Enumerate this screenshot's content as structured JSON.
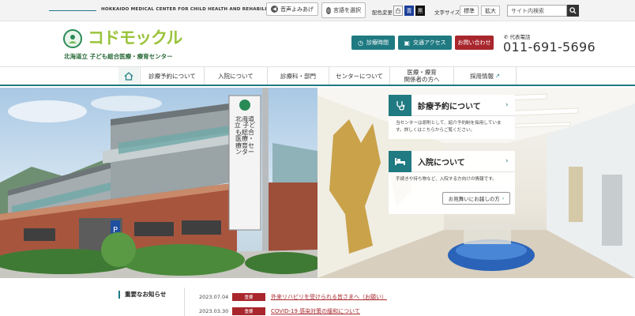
{
  "topbar": {
    "org_english": "HOKKAIDO MEDICAL CENTER FOR CHILD HEALTH AND REHABILITATION",
    "read_aloud": "音声よみあげ",
    "language": "言語を選択",
    "color_label": "配色変更",
    "color_white": "白",
    "color_blue": "青",
    "color_black": "黒",
    "text_size_label": "文字サイズ",
    "size_standard": "標準",
    "size_large": "拡大",
    "search_placeholder": "サイト内検索"
  },
  "header": {
    "logo_text": "コドモックル",
    "logo_sub": "北海道立 子ども総合医療・療育センター",
    "hours": "診療時間",
    "access": "交通アクセス",
    "contact": "お問い合わせ",
    "phone_label": "代表電話",
    "phone_number": "011-691-5696"
  },
  "nav": {
    "items": [
      {
        "label": "診療予約について"
      },
      {
        "label": "入院について"
      },
      {
        "label": "診療科・部門"
      },
      {
        "label": "センターについて"
      },
      {
        "label": "医療・療育\n関係者の方へ"
      },
      {
        "label": "採用情報"
      }
    ]
  },
  "hero": {
    "building_sign": "北海道立 子ども総合医療・療育センター",
    "card1": {
      "title": "診療予約について",
      "body": "当センターは原則として、紹介予約制を採用しています。詳しくはこちらからご覧ください。"
    },
    "card2": {
      "title": "入院について",
      "body": "手続きや持ち物など、入院する方向けの情報です。",
      "link": "お見舞いにお越しの方"
    }
  },
  "news": {
    "heading": "重要なお知らせ",
    "items": [
      {
        "date": "2023.07.04",
        "badge": "重要",
        "title": "外来リハビリを受けられる皆さまへ（お願い）"
      },
      {
        "date": "2023.03.30",
        "badge": "重要",
        "title": "COVID-19 感染対策の緩和について"
      }
    ]
  },
  "colors": {
    "teal": "#1f7a82",
    "red": "#a8262c",
    "logo_green": "#9ac43c"
  }
}
